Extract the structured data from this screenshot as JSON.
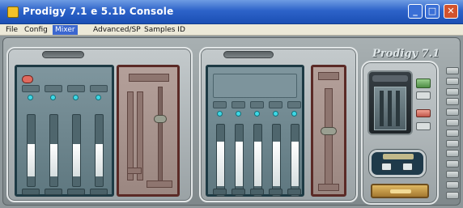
{
  "window": {
    "title": "Prodigy 7.1 e 5.1b Console"
  },
  "menu": {
    "items": [
      "File",
      "Config",
      "Mixer",
      "Advanced/SP",
      "Samples ID"
    ],
    "active": "Mixer"
  },
  "brand": {
    "logo_text": "Prodigy 7.1"
  },
  "colors": {
    "title_bar": "#2d63c9",
    "menu_bg": "#ece9d8",
    "panel_blue": "#5f7880",
    "panel_red": "#9b8781",
    "led_cyan": "#3ed8e6",
    "accent_orange": "#e06a5e",
    "accent_gold": "#c9a24a"
  },
  "channels": {
    "output": [
      {
        "level": 0.55
      },
      {
        "level": 0.55
      },
      {
        "level": 0.55
      },
      {
        "level": 0.55
      }
    ],
    "input": [
      {
        "level": 0.72
      },
      {
        "level": 0.72
      },
      {
        "level": 0.72
      },
      {
        "level": 0.72
      },
      {
        "level": 0.72
      }
    ],
    "master_out_level": 0.7,
    "master_in_level": 0.6
  },
  "icons": {
    "app": "app-icon",
    "minimize": "minimize-icon",
    "maximize": "maximize-icon",
    "close": "close-icon"
  }
}
